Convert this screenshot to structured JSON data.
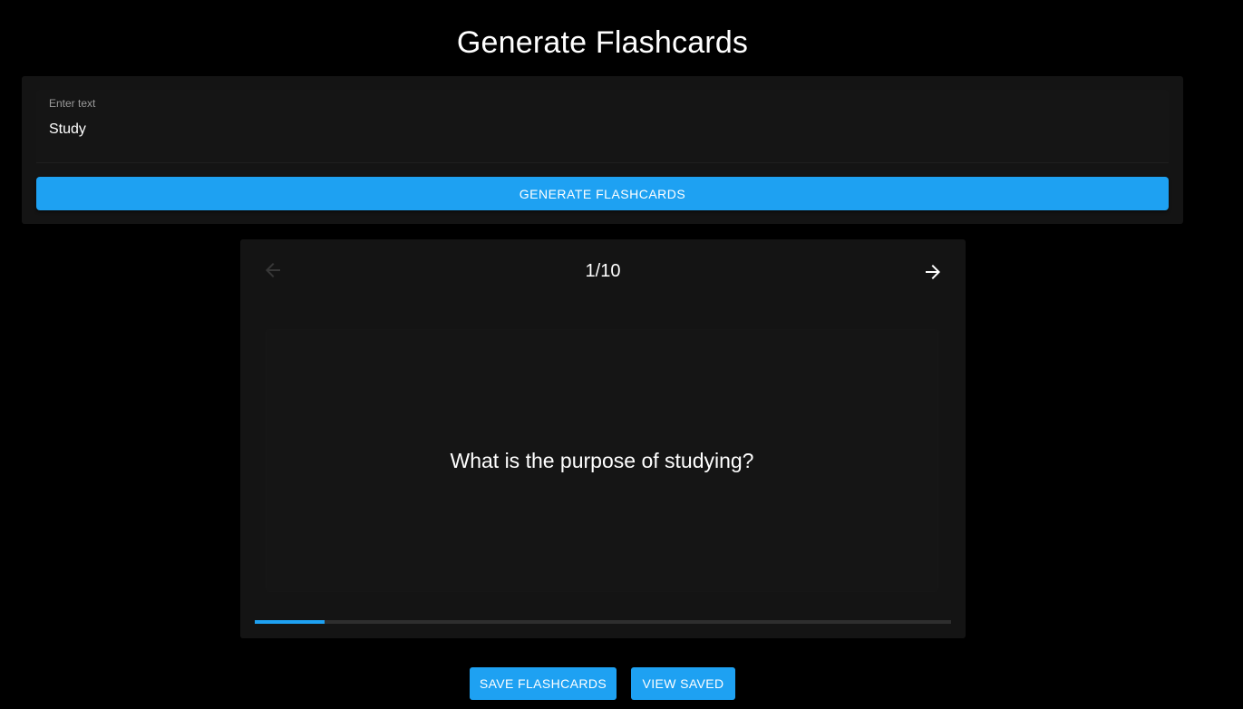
{
  "header": {
    "title": "Generate Flashcards"
  },
  "input": {
    "label": "Enter text",
    "value": "Study"
  },
  "generate_button": {
    "label": "GENERATE FLASHCARDS"
  },
  "flashcard": {
    "counter": "1/10",
    "current": 1,
    "total": 10,
    "question": "What is the purpose of studying?",
    "progress_fraction": 0.1
  },
  "actions": {
    "save_label": "SAVE FLASHCARDS",
    "view_label": "VIEW SAVED"
  },
  "colors": {
    "accent": "#1ea1f2",
    "background": "#000000",
    "panel": "#141414"
  },
  "icons": {
    "prev": "arrow-left-icon",
    "next": "arrow-right-icon"
  }
}
